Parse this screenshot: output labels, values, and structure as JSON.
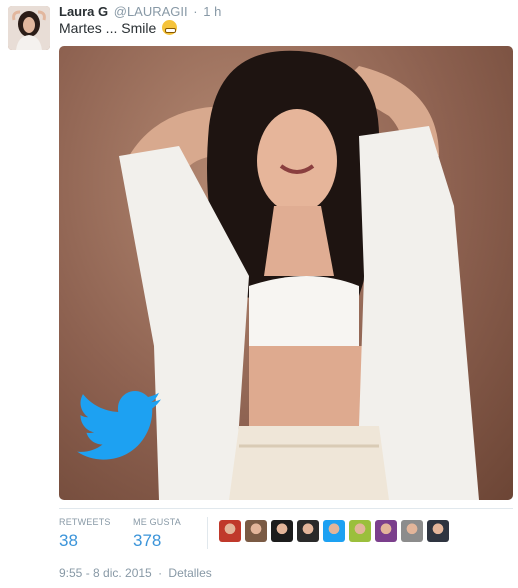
{
  "tweet": {
    "fullname": "Laura G",
    "username": "@LAURAGII",
    "separator": "·",
    "time": "1 h",
    "text": "Martes ... Smile",
    "emoji": "grinning-face"
  },
  "media": {
    "watermark_icon": "twitter-bird-icon",
    "accent_color": "#1da1f2"
  },
  "stats": {
    "retweets_label": "RETWEETS",
    "retweets_value": "38",
    "likes_label": "ME GUSTA",
    "likes_value": "378"
  },
  "likers": [
    {
      "icon": "avatar-1",
      "color": "#c0392b"
    },
    {
      "icon": "avatar-2",
      "color": "#7a5a44"
    },
    {
      "icon": "avatar-3",
      "color": "#1c1c1c"
    },
    {
      "icon": "avatar-4",
      "color": "#2a2a2a"
    },
    {
      "icon": "avatar-5",
      "color": "#1da1f2"
    },
    {
      "icon": "avatar-6",
      "color": "#9bbf3c"
    },
    {
      "icon": "avatar-7",
      "color": "#7b3f8c"
    },
    {
      "icon": "avatar-8",
      "color": "#8c8c8c"
    },
    {
      "icon": "avatar-9",
      "color": "#2e3440"
    }
  ],
  "footer": {
    "timestamp": "9:55 - 8 dic. 2015",
    "separator": "·",
    "details_link": "Detalles"
  }
}
